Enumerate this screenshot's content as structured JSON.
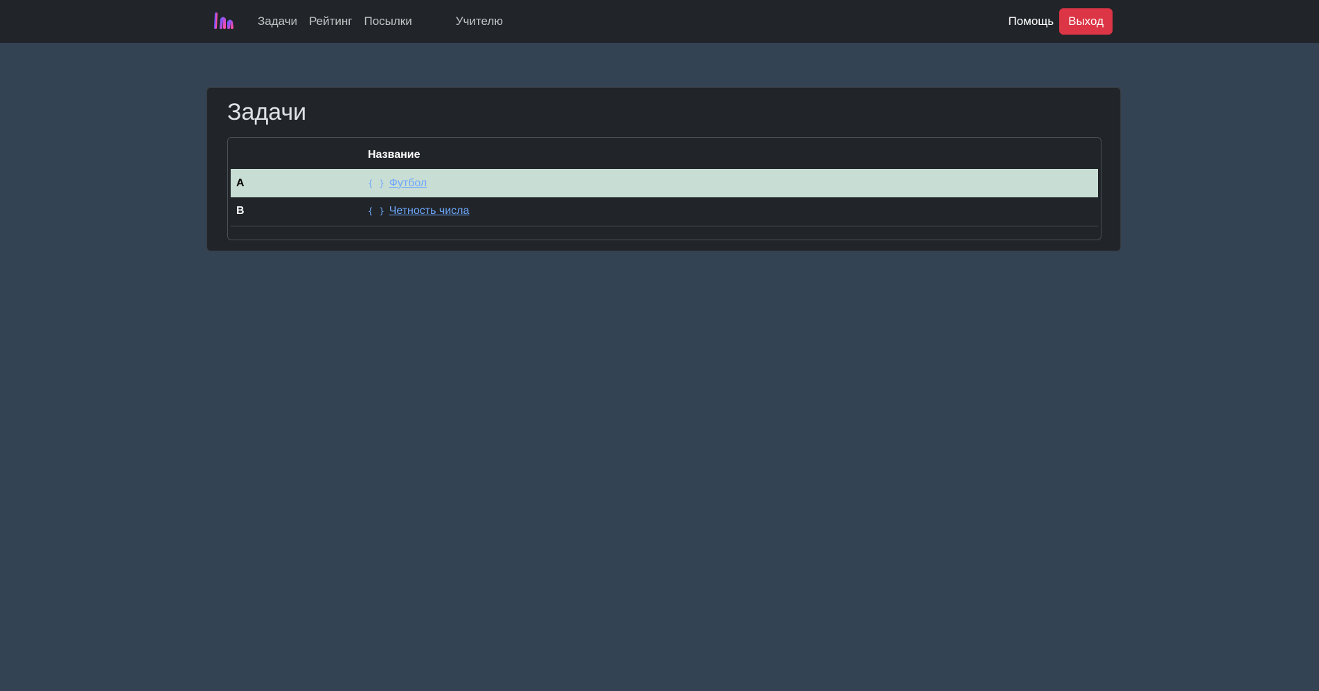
{
  "nav": {
    "logo_icon": "brand-logo-icon",
    "links": [
      "Задачи",
      "Рейтинг",
      "Посылки"
    ],
    "teacher_link": "Учителю",
    "help": "Помощь",
    "logout": "Выход"
  },
  "colors": {
    "navbar": "#212529",
    "background": "#344354",
    "accent_danger": "#dc3545",
    "link": "#6ea8fe",
    "highlight_row": "#c8ddd3"
  },
  "main": {
    "title": "Задачи",
    "table": {
      "headers": [
        "",
        "Название"
      ],
      "rows": [
        {
          "letter": "A",
          "icon": "code-braces-icon",
          "name": "Футбол",
          "highlighted": true
        },
        {
          "letter": "B",
          "icon": "code-braces-icon",
          "name": "Четность числа",
          "highlighted": false
        }
      ]
    }
  }
}
